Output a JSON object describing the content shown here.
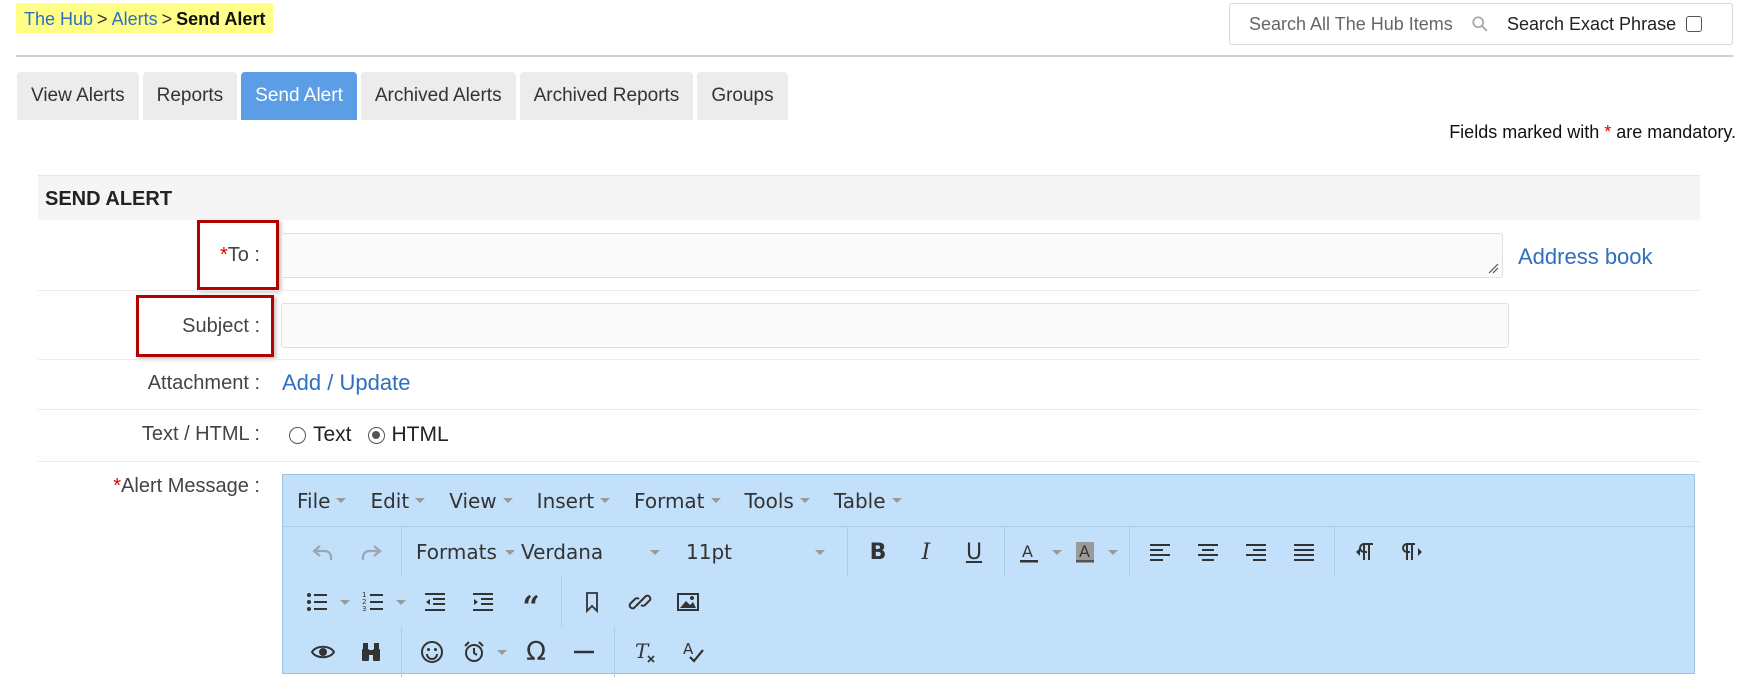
{
  "breadcrumb": {
    "root": "The Hub",
    "sep": ">",
    "section": "Alerts",
    "current": "Send Alert"
  },
  "search": {
    "placeholder": "Search All The Hub Items",
    "exact_label": "Search Exact Phrase",
    "exact_checked": false
  },
  "tabs": [
    {
      "label": "View Alerts",
      "active": false
    },
    {
      "label": "Reports",
      "active": false
    },
    {
      "label": "Send Alert",
      "active": true
    },
    {
      "label": "Archived Alerts",
      "active": false
    },
    {
      "label": "Archived Reports",
      "active": false
    },
    {
      "label": "Groups",
      "active": false
    }
  ],
  "mandatory_note": {
    "before": "Fields marked with ",
    "star": "*",
    "after": " are mandatory."
  },
  "form": {
    "section_title": "SEND ALERT",
    "to_star": "*",
    "to_label": "To :",
    "to_value": "",
    "address_book": "Address book",
    "subject_label": "Subject :",
    "subject_value": "",
    "attachment_label": "Attachment :",
    "attachment_link": "Add / Update",
    "format_label": "Text / HTML :",
    "format_options": [
      "Text",
      "HTML"
    ],
    "format_selected": "HTML",
    "message_star": "*",
    "message_label": "Alert Message :"
  },
  "editor": {
    "menus": [
      "File",
      "Edit",
      "View",
      "Insert",
      "Format",
      "Tools",
      "Table"
    ],
    "formats_label": "Formats",
    "font_family": "Verdana",
    "font_size": "11pt",
    "colors": {
      "background": "#c2e0fa",
      "accent": "#5b9ee6",
      "highlight": "#b30000"
    }
  }
}
